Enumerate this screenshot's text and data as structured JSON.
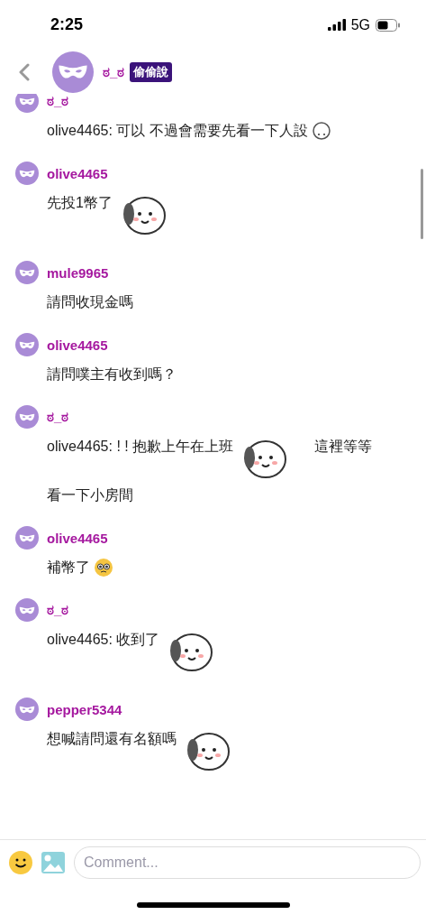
{
  "status_bar": {
    "time": "2:25",
    "network": "5G"
  },
  "header": {
    "title": "ಠ_ಠ",
    "badge": "偷偷說"
  },
  "messages": [
    {
      "user": "ಠ_ಠ",
      "lines": [
        [
          {
            "kind": "text",
            "text": "olive4465: 可以 不過會需要先看一下人設"
          },
          {
            "kind": "small-sticker"
          }
        ]
      ]
    },
    {
      "user": "olive4465",
      "lines": [
        [
          {
            "kind": "text",
            "text": "先投1幣了"
          },
          {
            "kind": "sticker"
          }
        ]
      ]
    },
    {
      "user": "mule9965",
      "lines": [
        [
          {
            "kind": "text",
            "text": "請問收現金嗎"
          }
        ]
      ]
    },
    {
      "user": "olive4465",
      "lines": [
        [
          {
            "kind": "text",
            "text": "請問噗主有收到嗎？"
          }
        ]
      ]
    },
    {
      "user": "ಠ_ಠ",
      "lines": [
        [
          {
            "kind": "text",
            "text": "olive4465: ! ! 抱歉上午在上班"
          },
          {
            "kind": "sticker"
          },
          {
            "kind": "text",
            "text": "這裡等等"
          }
        ],
        [
          {
            "kind": "text",
            "text": "看一下小房間"
          }
        ]
      ]
    },
    {
      "user": "olive4465",
      "lines": [
        [
          {
            "kind": "text",
            "text": "補幣了"
          },
          {
            "kind": "emoji"
          }
        ]
      ]
    },
    {
      "user": "ಠ_ಠ",
      "lines": [
        [
          {
            "kind": "text",
            "text": "olive4465: 收到了"
          },
          {
            "kind": "sticker"
          }
        ]
      ]
    },
    {
      "user": "pepper5344",
      "lines": [
        [
          {
            "kind": "text",
            "text": "想喊請問還有名額嗎"
          },
          {
            "kind": "sticker"
          }
        ]
      ]
    }
  ],
  "comment_bar": {
    "placeholder": "Comment..."
  }
}
